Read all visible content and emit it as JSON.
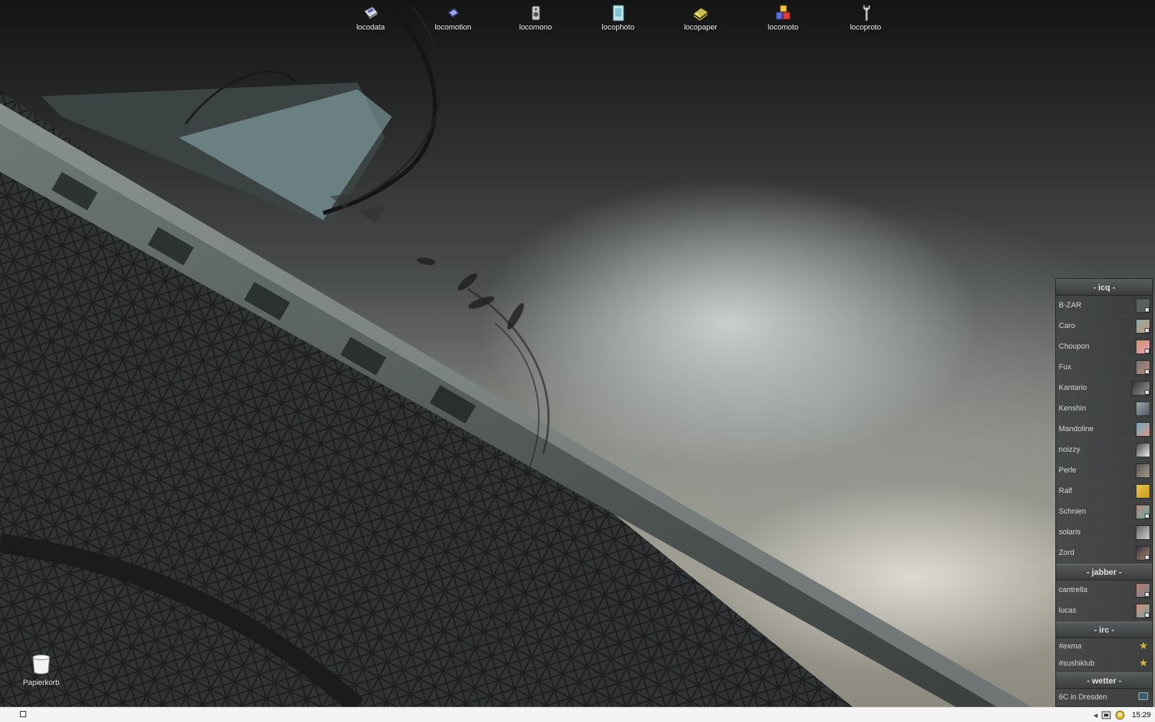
{
  "desktop": {
    "icons": [
      {
        "label": "locodata",
        "icon": "floppy-disk-icon"
      },
      {
        "label": "locomotion",
        "icon": "film-clip-icon"
      },
      {
        "label": "locomono",
        "icon": "speaker-icon"
      },
      {
        "label": "locophoto",
        "icon": "photo-frame-icon"
      },
      {
        "label": "locopaper",
        "icon": "paper-stack-icon"
      },
      {
        "label": "locomoto",
        "icon": "blocks-icon"
      },
      {
        "label": "locoproto",
        "icon": "wrench-icon"
      }
    ],
    "trash_label": "Papierkorb"
  },
  "contact_list": {
    "groups": [
      {
        "title": "- icq -",
        "contacts": [
          "B-ZAR",
          "Caro",
          "Choupon",
          "Fux",
          "Kantario",
          "Kenshin",
          "Mandoline",
          "noizzy",
          "Perle",
          "Ralf",
          "Schnien",
          "solaris",
          "Zord"
        ]
      },
      {
        "title": "- jabber -",
        "contacts": [
          "cantrella",
          "lucas"
        ]
      },
      {
        "title": "- irc -",
        "contacts": [
          "#exma",
          "#sushiklub"
        ]
      },
      {
        "title": "- wetter -",
        "contacts": [
          "6C in Dresden"
        ]
      }
    ]
  },
  "taskbar": {
    "clock": "15:29"
  },
  "colors": {
    "panel_bg": "#373a3a",
    "star": "#d8b43c",
    "taskbar_bg": "#f4f4f4"
  }
}
